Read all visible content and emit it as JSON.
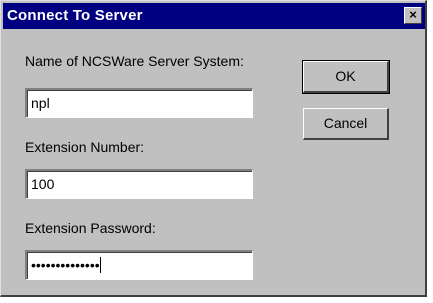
{
  "window": {
    "title": "Connect To Server",
    "close_glyph": "×",
    "title_bar_color": "#000080"
  },
  "form": {
    "server_label": "Name of NCSWare Server System:",
    "server_value": "npl",
    "extension_label": "Extension Number:",
    "extension_value": "100",
    "password_label": "Extension Password:",
    "password_value": "••••••••••••••"
  },
  "buttons": {
    "ok_label": "OK",
    "cancel_label": "Cancel"
  }
}
